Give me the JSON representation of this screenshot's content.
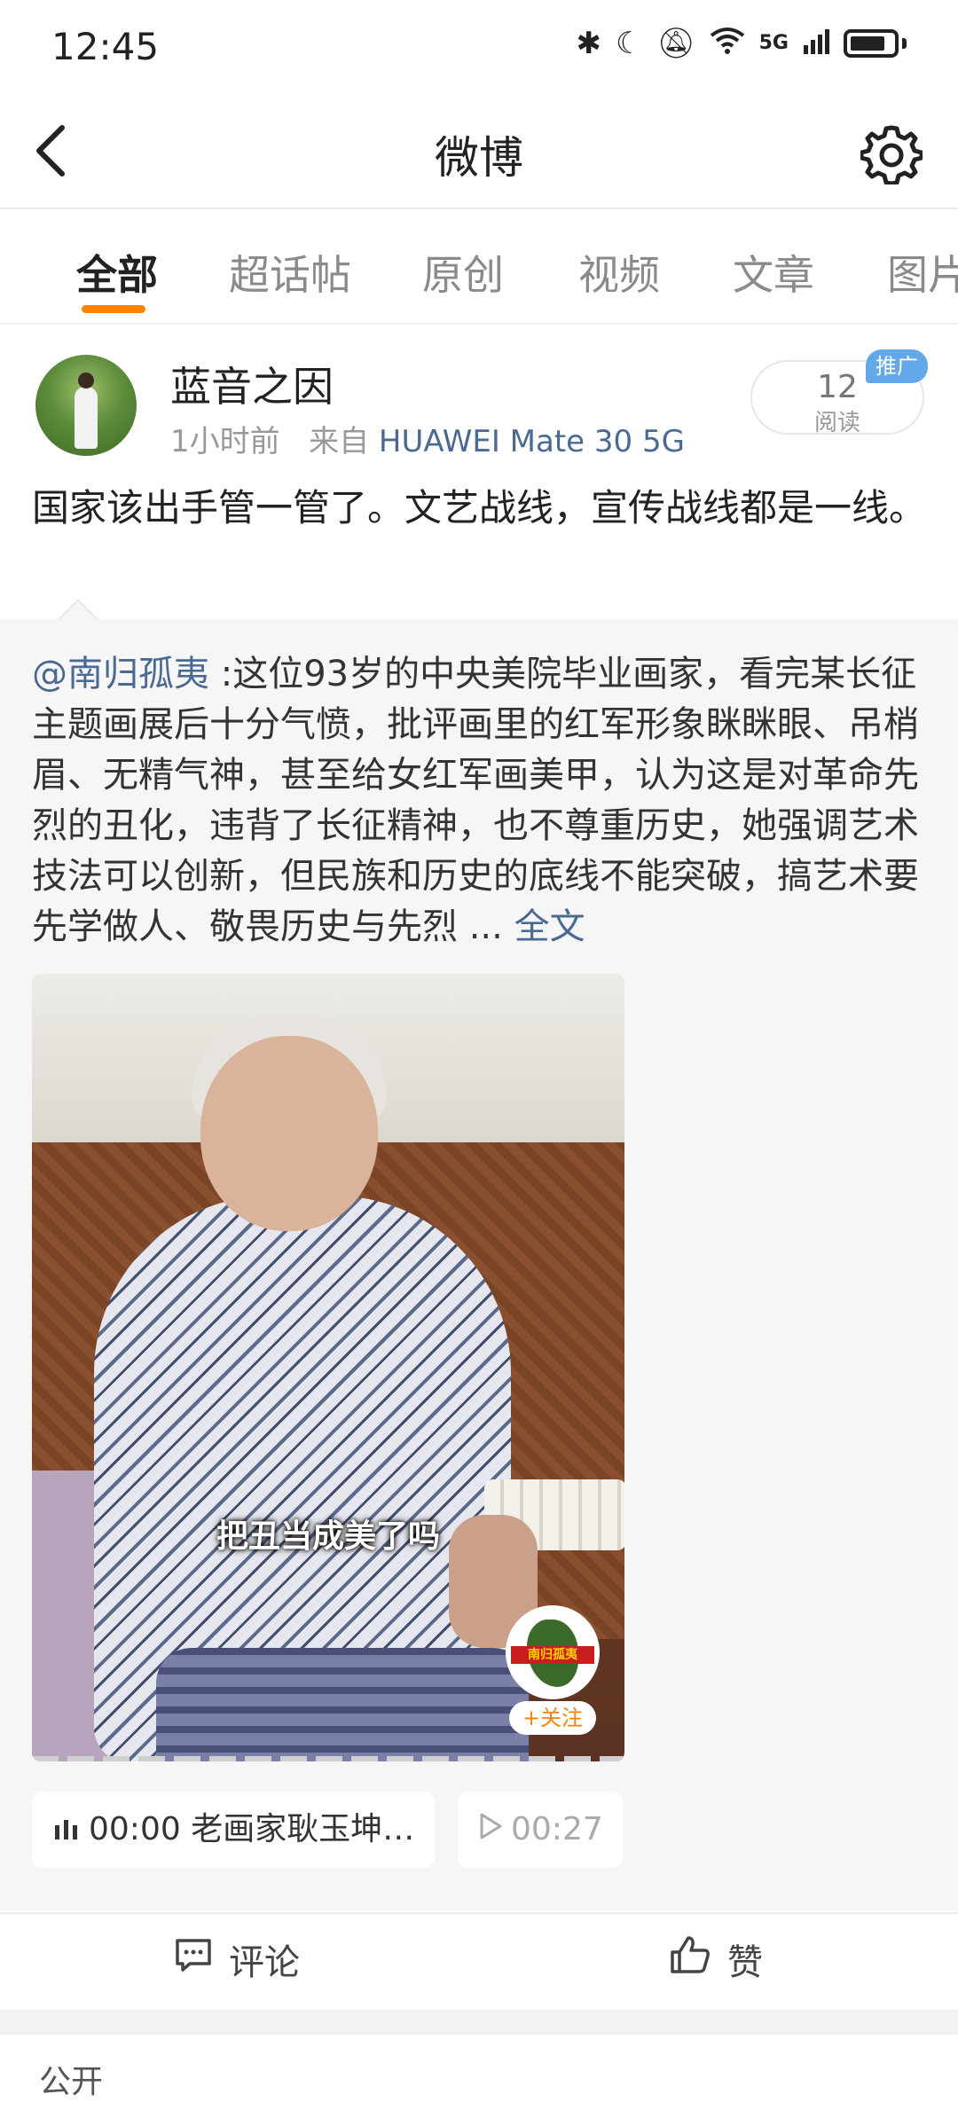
{
  "status_bar": {
    "time": "12:45",
    "icons": [
      "bluetooth-icon",
      "moon-icon",
      "mute-icon",
      "wifi-icon",
      "5g-signal-icon",
      "battery-icon"
    ],
    "network": "5G"
  },
  "nav": {
    "title": "微博",
    "back_icon": "back-arrow-icon",
    "settings_icon": "gear-icon"
  },
  "tabs": [
    {
      "label": "全部",
      "active": true
    },
    {
      "label": "超话帖",
      "active": false
    },
    {
      "label": "原创",
      "active": false
    },
    {
      "label": "视频",
      "active": false
    },
    {
      "label": "文章",
      "active": false
    },
    {
      "label": "图片",
      "active": false
    }
  ],
  "post": {
    "username": "蓝音之因",
    "time": "1小时前",
    "from_prefix": "来自",
    "device": "HUAWEI Mate 30 5G",
    "read_count": "12",
    "read_label": "阅读",
    "promo_badge": "推广",
    "text": "国家该出手管一管了。文艺战线，宣传战线都是一线。"
  },
  "repost": {
    "mention": "@南归孤夷",
    "text": " :这位93岁的中央美院毕业画家，看完某长征主题画展后十分气愤，批评画里的红军形象眯眯眼、吊梢眉、无精气神，甚至给女红军画美甲，认为这是对革命先烈的丑化，违背了长征精神，也不尊重历史，她强调艺术技法可以创新，但民族和历史的底线不能突破，搞艺术要先学做人、敬畏历史与先烈 ... ",
    "full_text_link": "全文",
    "video": {
      "subtitle": "把丑当成美了吗",
      "logo_text": "南归孤夷",
      "follow_label": "+关注"
    },
    "audio_chips": [
      {
        "icon": "audio-bars-icon",
        "time": "00:00",
        "title": "老画家耿玉坤…"
      },
      {
        "icon": "play-icon",
        "time": "00:27",
        "title": ""
      }
    ]
  },
  "actions": {
    "comment_label": "评论",
    "like_label": "赞"
  },
  "next_card": {
    "text": "公开"
  }
}
